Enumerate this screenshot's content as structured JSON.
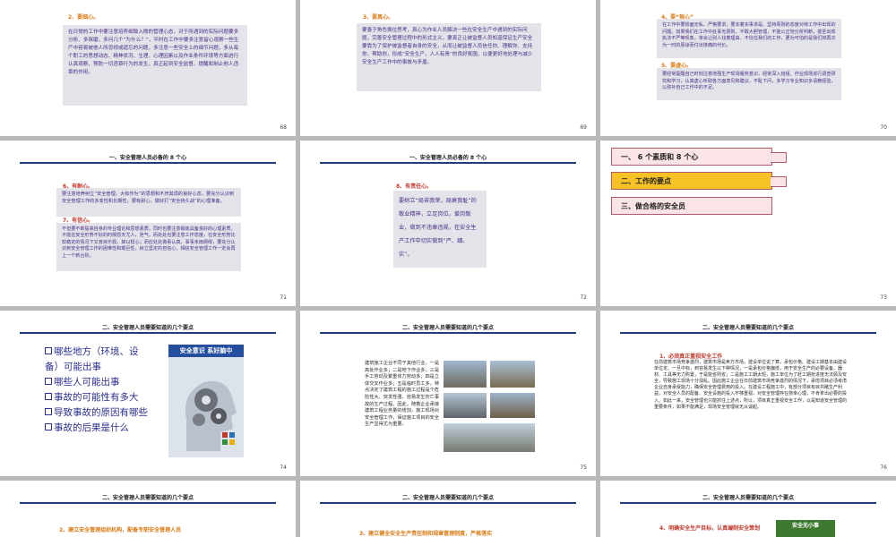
{
  "slides": {
    "s68": {
      "page": "68",
      "sub": "2、要细心。",
      "body": "在日常的工作中要注意培养细致入微的管理心态，对于所遇到的实际问题要多分析、多琢磨，多问几个“为什么？”，平时在工作中要多注意留心观察一些生产中容易被他人所忽视或遗忘的问题，多注意一些安全上的细节问题，多从每个职工的思想动态、精神状况、生理、心理因素以及作业条件环境等方面进行认真观察，预防一切违章行为的发生，真正起到安全监督、提醒和制止他人违章的作用。"
    },
    "s69": {
      "page": "69",
      "sub": "3、要真心。",
      "body": "要善于角色换位思考，真心为作业人员解决一些在安全生产中遇到的实际问题，完善安全管理过程中的形式主义，要真正让被监督人员知道保证生产安全要靠为了保护被监督者自身的安全，从而让被监督人员信任你、理解你、支持你、帮助你，形成“安全生产，人人有责”的良好氛围，以便更好地处理与减少安全生产工作中的事故与矛盾。"
    },
    "s70": {
      "page": "70",
      "sub4": "4、要“狠心”",
      "body4": "在工作中要铁面无私、严格要求，要本着实事求是、坚持原则的态度对待工作中出现的问题。如果我们在工作中处事无原则，不敢大胆管理，不能公正地分析判断，甚至出现执法不严等现象，将会让别人找着理由、不信任我们的工作，更为可怕的是我们将再次为一时的原谅而付出惨痛的代价。",
      "sub5": "5、要虚心。",
      "body5": "要经常提醒自己时刻注意增强生产现场服务意识，经常深入班组、作业现场进行调查研究和学习，认真虚心听取各方面意见和建议，不耻下问，多学习专业知识多请教经验，以弥补自己工作中的不足。"
    },
    "s71": {
      "page": "71",
      "header": "一、安全管理人员必备的 8 个心",
      "sub6": "6、有耐心。",
      "body6": "要注意培养树立“安全管理，大有作为”的思想和不厌其烦的良好心态，要充分认识到安全管理工作的多变性和长期性，要有耐心，做好打“安全持久战”的心理准备。",
      "sub7": "7、有信心。",
      "body7": "不但要不断提高自身的专业理论和思想素质，同时也要注意锻炼具备良好的心理素质。不能在安全形势不好的时候怨天尤人，泄气，而处处也要注意工作态度，在安全形势比较稳定的情况下又盲目乐观，掉以轻心；而应处处做事认真，事事未雨绸缪，要充分认识到安全管理工作的困难性和艰巨性，树立坚定的自信心，相信安全管理工作一定会再上一个新台阶。"
    },
    "s72": {
      "page": "72",
      "header": "一、安全管理人员必备的 8 个心",
      "sub": "8、有责任心。",
      "body": "要树立“局苦我荣，局衰我耻”的敬业精神，立足岗位，爱岗敬业，做到不违章违规，在安全生产工作中切实做到“严、细、实”。"
    },
    "s73": {
      "page": "73",
      "items": [
        "一、 6 个素质和 8 个心",
        "二、工作的要点",
        "三、做合格的安全员"
      ]
    },
    "s74": {
      "page": "74",
      "header": "二、安全管理人员需要知道的几个要点",
      "bullets": [
        "哪些地方（环境、设备）可能出事",
        "哪些人可能出事",
        "事故的可能性有多大",
        "导致事故的原因有哪些",
        "事故的后果是什么"
      ],
      "banner": "安全意识 系好脑中"
    },
    "s75": {
      "page": "75",
      "header": "二、安全管理人员需要知道的几个要点",
      "body": "建筑施工企业不同于其他行业，一是高处作业多；二是地下作业多；三是手工劳动及繁重体力劳动多；四是立体交叉作业多；五是临时员工多，特点决定了建筑工程的施工过程是个危险性大、突发性强、容易发生伤亡事故的生产过程。因此，随着企业承接建筑工程业务量的增加，施工现场对安全管理工作，保证施工项目的安全生产显得尤为重要。"
    },
    "s76": {
      "page": "76",
      "header": "二、安全管理人员需要知道的几个要点",
      "sub": "1、必须真正重视安全工作",
      "body": "在前建筑市场竞争激烈，建筑市场是卖方市场，建设单位说了算，承包价格、建设工期基本由建设单位定。一旦中标，到容易发生以下种情况，一是承包价格偏低，用于安全生产的必要设备、器材、工具等无力购置，于是能省则省；二是施工工期太短，施工单位为了赶工期抢进度无法顾及安全，导致施工现场十分混乱。因此施工企业在日前建筑市场竞争激烈的情况下，承揽项目必须考虑企业自身承受能力，确保安全管理费用的投入。在建设工程施工中，有部分项目有目共睹生产利益，对安全人员的配备、安全设施的投入不够重视，对安全管理存在侥幸心理，不肯拿出必要的投入。如此一来，安全管理也只能抓住上述点，所以，项目真正重视安全工作，以是知道安全管理的重要条件，如果不能满足，现场安全管理就无从谈起。"
    },
    "s77": {
      "header": "二、安全管理人员需要知道的几个要点",
      "sub": "2、建立安全管理组织机构，配备专职安全管理人员"
    },
    "s78": {
      "header": "二、安全管理人员需要知道的几个要点",
      "sub": "3、建立健全安全生产责任制和规章管理制度，严格落实"
    },
    "s79": {
      "header": "二、安全管理人员需要知道的几个要点",
      "sub": "4、明确安全生产目标，认真编制安全策划",
      "badge": "安全无小事"
    }
  }
}
